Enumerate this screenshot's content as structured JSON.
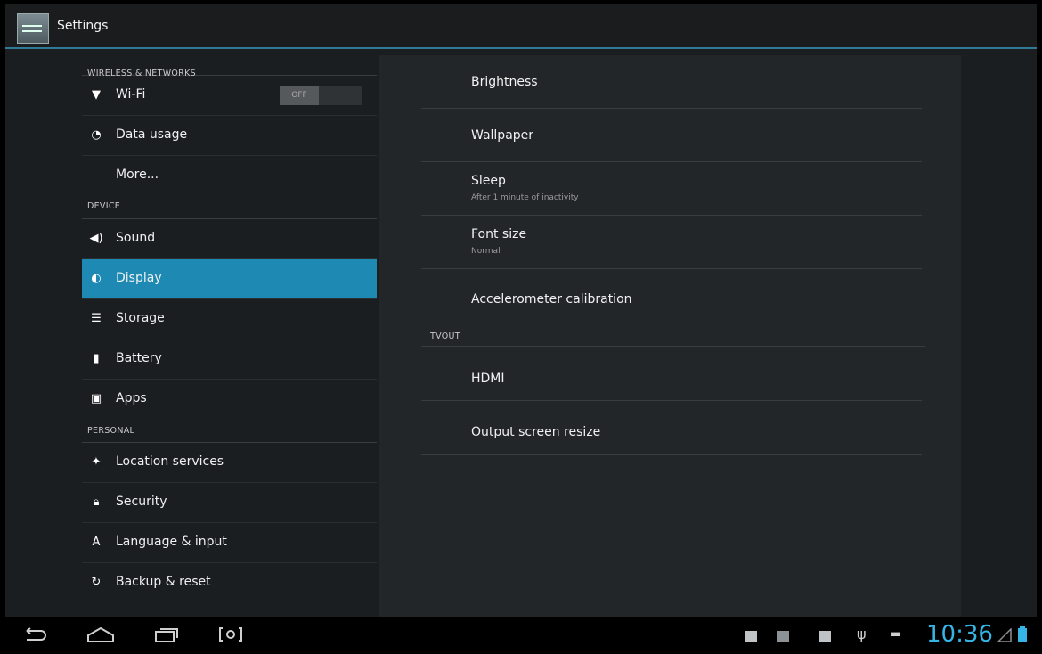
{
  "actionbar": {
    "title": "Settings",
    "icon": "settings-icon"
  },
  "sidebar": {
    "headers": {
      "wireless": "WIRELESS & NETWORKS",
      "device": "DEVICE",
      "personal": "PERSONAL"
    },
    "wifi": {
      "label": "Wi-Fi",
      "toggle_state": "OFF"
    },
    "data_usage": {
      "label": "Data usage"
    },
    "more": {
      "label": "More..."
    },
    "sound": {
      "label": "Sound"
    },
    "display": {
      "label": "Display"
    },
    "storage": {
      "label": "Storage"
    },
    "battery": {
      "label": "Battery"
    },
    "apps": {
      "label": "Apps"
    },
    "location": {
      "label": "Location services"
    },
    "security": {
      "label": "Security"
    },
    "language": {
      "label": "Language & input"
    },
    "backup": {
      "label": "Backup & reset"
    },
    "selected": "Display",
    "accent_color": "#1e8ab4"
  },
  "display_settings": {
    "brightness": {
      "title": "Brightness"
    },
    "wallpaper": {
      "title": "Wallpaper"
    },
    "sleep": {
      "title": "Sleep",
      "summary": "After 1 minute of inactivity"
    },
    "font_size": {
      "title": "Font size",
      "summary": "Normal"
    },
    "accelerometer": {
      "title": "Accelerometer calibration"
    },
    "tvout_header": "TVOUT",
    "hdmi": {
      "title": "HDMI"
    },
    "output_resize": {
      "title": "Output screen resize"
    }
  },
  "navbar": {
    "clock": "10:36",
    "clock_color": "#35b5e5",
    "buttons": [
      "back-icon",
      "home-icon",
      "recent-apps-icon",
      "screenshot-icon"
    ],
    "status_icons": [
      "notification-icon",
      "gallery-icon",
      "notification-icon",
      "usb-icon",
      "android-debug-icon",
      "wifi-signal-icon",
      "battery-icon"
    ]
  }
}
